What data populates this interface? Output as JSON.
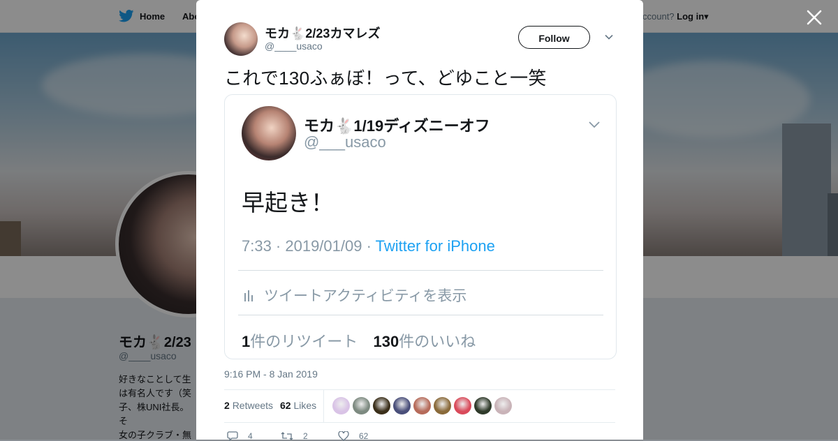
{
  "background": {
    "nav": {
      "home_label": "Home",
      "about_label": "Abo",
      "account_prompt": "ccount?",
      "login_label": "Log in"
    },
    "profile": {
      "name": "モカ🐇2/23",
      "handle": "@____usaco",
      "bio": "好きなことして生\nは有名人です（笑\n子、株UNI社長。そ\n女の子クラブ・無\nす✨モカ🐇ファ"
    }
  },
  "tweet": {
    "author_name": "モカ🐇2/23カマレズ",
    "author_handle": "@____usaco",
    "follow_label": "Follow",
    "text": "これで130ふぁぼ！って、どゆこと一笑",
    "timestamp": "9:16 PM - 8 Jan 2019",
    "retweets_count": "2",
    "retweets_label": "Retweets",
    "likes_count": "62",
    "likes_label": "Likes",
    "actions": {
      "replies": "4",
      "retweets": "2",
      "likes": "62"
    }
  },
  "embedded_screenshot": {
    "name": "モカ🐇1/19ディズニーオフ",
    "handle": "@___usaco",
    "text": "早起き！",
    "time": "7:33 · 2019/01/09 · ",
    "source": "Twitter for iPhone",
    "activity_label": "ツイートアクティビティを表示",
    "retweet_count": "1",
    "retweet_label": "件のリツイート",
    "like_count": "130",
    "like_label": "件のいいね"
  },
  "colors": {
    "accent": "#1da1f2",
    "text": "#14171a",
    "muted": "#657786"
  },
  "likers": [
    {
      "color": "#d9c3e6"
    },
    {
      "color": "#7d8a80"
    },
    {
      "color": "#3b2f1a"
    },
    {
      "color": "#4a4f7a"
    },
    {
      "color": "#b66b5a"
    },
    {
      "color": "#8a6a3a"
    },
    {
      "color": "#d94a5a"
    },
    {
      "color": "#2f3a2a"
    },
    {
      "color": "#c9b3b8"
    }
  ]
}
